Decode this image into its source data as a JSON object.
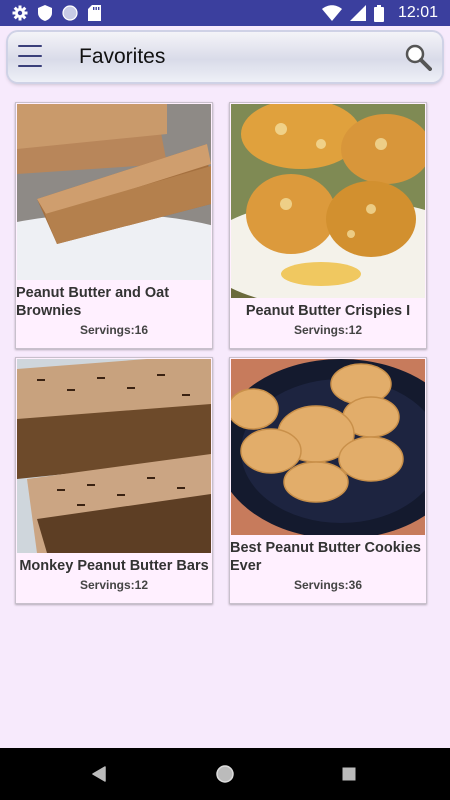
{
  "status_bar": {
    "time": "12:01",
    "left_icons": [
      "gear-icon",
      "shield-icon",
      "circle-icon",
      "sd-card-icon"
    ],
    "right_icons": [
      "wifi-icon",
      "signal-icon",
      "battery-icon"
    ],
    "bg_color": "#3b3f9e"
  },
  "app_bar": {
    "title": "Favorites",
    "menu_icon": "hamburger-menu-icon",
    "search_icon": "search-icon"
  },
  "recipes": [
    {
      "name": "Peanut Butter and Oat Brownies",
      "servings": "Servings:16"
    },
    {
      "name": "Peanut Butter Crispies I",
      "servings": "Servings:12"
    },
    {
      "name": "Monkey Peanut Butter Bars",
      "servings": "Servings:12"
    },
    {
      "name": "Best Peanut Butter Cookies Ever",
      "servings": "Servings:36"
    }
  ],
  "nav_bar": {
    "back_icon": "back-triangle-icon",
    "home_icon": "home-circle-icon",
    "recents_icon": "recents-square-icon"
  }
}
